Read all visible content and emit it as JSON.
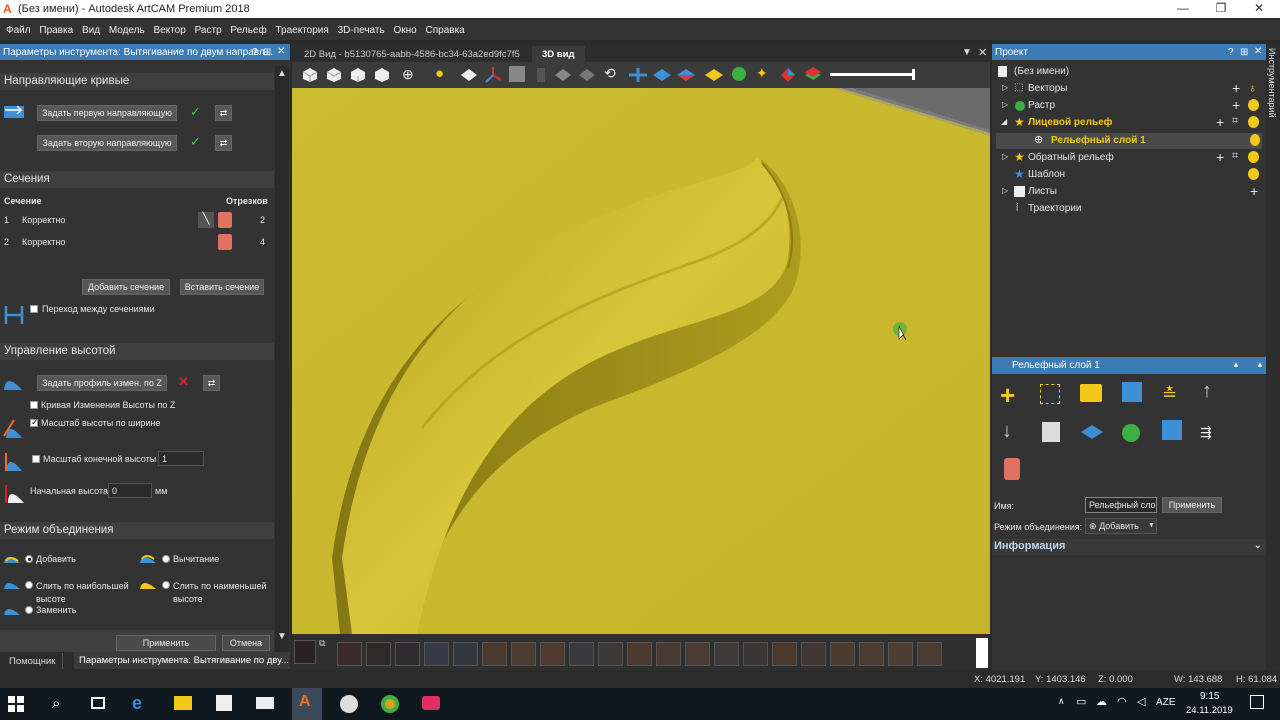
{
  "window": {
    "title": "(Без имени) - Autodesk ArtCAM Premium 2018",
    "logo": "A"
  },
  "menu": [
    "Файл",
    "Правка",
    "Вид",
    "Модель",
    "Вектор",
    "Растр",
    "Рельеф",
    "Траектория",
    "3D-печать",
    "Окно",
    "Справка"
  ],
  "left_panel": {
    "header": "Параметры инструмента: Вытягивание по двум направл...",
    "guides": {
      "title": "Направляющие кривые",
      "btn1": "Задать первую направляющую",
      "btn2": "Задать вторую направляющую"
    },
    "sections": {
      "title": "Сечения",
      "col_section": "Сечение",
      "col_segments": "Отрезков",
      "rows": [
        {
          "n": "1",
          "status": "Корректно",
          "count": "2"
        },
        {
          "n": "2",
          "status": "Корректно",
          "count": "4"
        }
      ],
      "add_btn": "Добавить сечение",
      "insert_btn": "Вставить сечение",
      "transition": "Переход между сечениями"
    },
    "height": {
      "title": "Управление высотой",
      "profile_btn": "Задать профиль измен. по Z",
      "curve_z": "Кривая Изменения Высоты по Z",
      "scale_width": "Масштаб высоты по ширине",
      "scale_final": "Масштаб конечной высоты",
      "scale_final_value": "1",
      "start_height": "Начальная высота",
      "start_height_value": "0",
      "unit": "мм"
    },
    "combine": {
      "title": "Режим объединения",
      "add": "Добавить",
      "subtract": "Вычитание",
      "merge_high": "Слить по наибольшей высоте",
      "merge_low": "Слить по наименьшей высоте",
      "replace": "Заменить"
    },
    "apply": "Применить",
    "cancel": "Отмена",
    "bottom_tabs": [
      "Помощник",
      "Параметры инструмента: Вытягивание по дву..."
    ]
  },
  "tabs": [
    "2D Вид - b5130765-aabb-4586-bc34-63a2ed9fc7f5",
    "3D вид"
  ],
  "right_panel": {
    "header": "Проект",
    "side_label": "Инструментарий",
    "tree": {
      "root": "(Без имени)",
      "vectors": "Векторы",
      "raster": "Растр",
      "front_relief": "Лицевой рельеф",
      "relief_layer": "Рельефный слой 1",
      "back_relief": "Обратный рельеф",
      "template": "Шаблон",
      "sheets": "Листы",
      "toolpaths": "Траектории"
    },
    "layer_header": "Рельефный слой 1",
    "name_label": "Имя:",
    "name_value": "Рельефный слой",
    "apply": "Применить",
    "mode_label": "Режим объединения:",
    "mode_value": "Добавить",
    "info": "Информация"
  },
  "status": {
    "x": "X: 4021.191",
    "y": "Y: 1403.146",
    "z": "Z: 0.000",
    "w": "W: 143.688",
    "h": "H: 61.084"
  },
  "taskbar": {
    "lang": "AZE",
    "time": "9:15",
    "date": "24.11.2019"
  },
  "colors": {
    "accent": "#3d7bb5",
    "relief": "#c9b92f",
    "tree_highlight": "#f2c81a"
  }
}
